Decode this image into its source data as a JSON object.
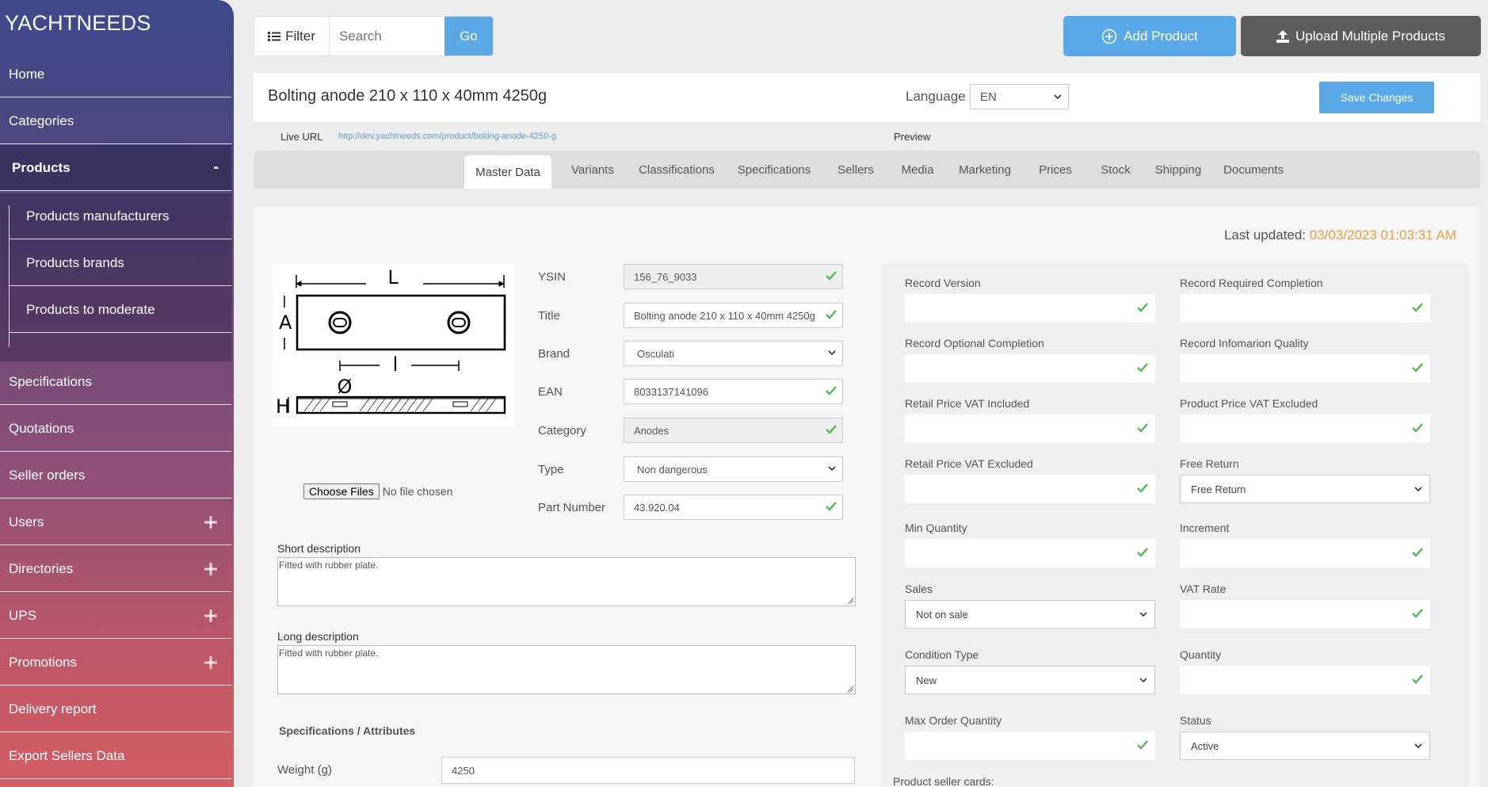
{
  "app": {
    "brand": "YACHTNEEDS"
  },
  "sidebar": {
    "items": [
      {
        "label": "Home"
      },
      {
        "label": "Categories"
      },
      {
        "label": "Products",
        "state": "-"
      },
      {
        "label": "Specifications"
      },
      {
        "label": "Quotations"
      },
      {
        "label": "Seller orders"
      },
      {
        "label": "Users"
      },
      {
        "label": "Directories"
      },
      {
        "label": "UPS"
      },
      {
        "label": "Promotions"
      },
      {
        "label": "Delivery report"
      },
      {
        "label": "Export Sellers Data"
      }
    ],
    "subitems": [
      {
        "label": "Products manufacturers"
      },
      {
        "label": "Products brands"
      },
      {
        "label": "Products to moderate"
      }
    ]
  },
  "topbar": {
    "filter_label": "Filter",
    "search_placeholder": "Search",
    "go_label": "Go",
    "add_product_label": "Add Product",
    "upload_label": "Upload Multiple Products"
  },
  "header": {
    "title": "Bolting anode 210 x 110 x 40mm 4250g",
    "language_label": "Language",
    "language_value": "EN",
    "save_label": "Save Changes",
    "live_url_label": "Live URL",
    "live_url": "http://dev.yachtneeds.com/product/bolting-anode-4250-g",
    "preview_label": "Preview"
  },
  "tabs": [
    "Master Data",
    "Variants",
    "Classifications",
    "Specifications",
    "Sellers",
    "Media",
    "Marketing",
    "Prices",
    "Stock",
    "Shipping",
    "Documents"
  ],
  "active_tab": "Master Data",
  "panel": {
    "last_updated_label": "Last updated:",
    "last_updated_value": "03/03/2023 01:03:31 AM",
    "image_labels": {
      "L": "L",
      "A": "A",
      "l": "l",
      "diameter": "Ø",
      "H": "H"
    },
    "choose_files_label": "Choose Files",
    "no_file_label": "No file chosen",
    "fields": {
      "ysin": {
        "label": "YSIN",
        "value": "156_76_9033"
      },
      "title": {
        "label": "Title",
        "value": "Bolting anode 210 x 110 x 40mm 4250g"
      },
      "brand": {
        "label": "Brand",
        "value": "Osculati"
      },
      "ean": {
        "label": "EAN",
        "value": "8033137141096"
      },
      "category": {
        "label": "Category",
        "value": "Anodes"
      },
      "type": {
        "label": "Type",
        "value": "Non dangerous"
      },
      "part_number": {
        "label": "Part Number",
        "value": "43.920.04"
      }
    },
    "short_description": {
      "label": "Short description",
      "value": "Fitted with rubber plate."
    },
    "long_description": {
      "label": "Long description",
      "value": "Fitted with rubber plate."
    },
    "specs_title": "Specifications / Attributes",
    "weight": {
      "label": "Weight (g)",
      "value": "4250"
    },
    "right": {
      "record_version": {
        "label": "Record Version",
        "value": ""
      },
      "record_required_completion": {
        "label": "Record Required Completion",
        "value": ""
      },
      "record_optional_completion": {
        "label": "Record Optional Completion",
        "value": ""
      },
      "record_information_quality": {
        "label": "Record Infomarion Quality",
        "value": ""
      },
      "retail_price_vat_included": {
        "label": "Retail Price VAT Included",
        "value": ""
      },
      "product_price_vat_excluded": {
        "label": "Product Price VAT Excluded",
        "value": ""
      },
      "retail_price_vat_excluded": {
        "label": "Retail Price VAT Excluded",
        "value": ""
      },
      "free_return": {
        "label": "Free Return",
        "value": "Free Return"
      },
      "min_quantity": {
        "label": "Min Quantity",
        "value": ""
      },
      "increment": {
        "label": "Increment",
        "value": ""
      },
      "sales": {
        "label": "Sales",
        "value": "Not on sale"
      },
      "vat_rate": {
        "label": "VAT Rate",
        "value": ""
      },
      "condition_type": {
        "label": "Condition Type",
        "value": "New"
      },
      "quantity": {
        "label": "Quantity",
        "value": ""
      },
      "max_order_quantity": {
        "label": "Max Order Quantity",
        "value": ""
      },
      "status": {
        "label": "Status",
        "value": "Active"
      },
      "seller_cards_label": "Product seller cards:"
    }
  },
  "colors": {
    "accent": "#5aa9e6",
    "check": "#5cb85c",
    "date": "#e8a03a",
    "dark_button": "#5d5d5d"
  }
}
